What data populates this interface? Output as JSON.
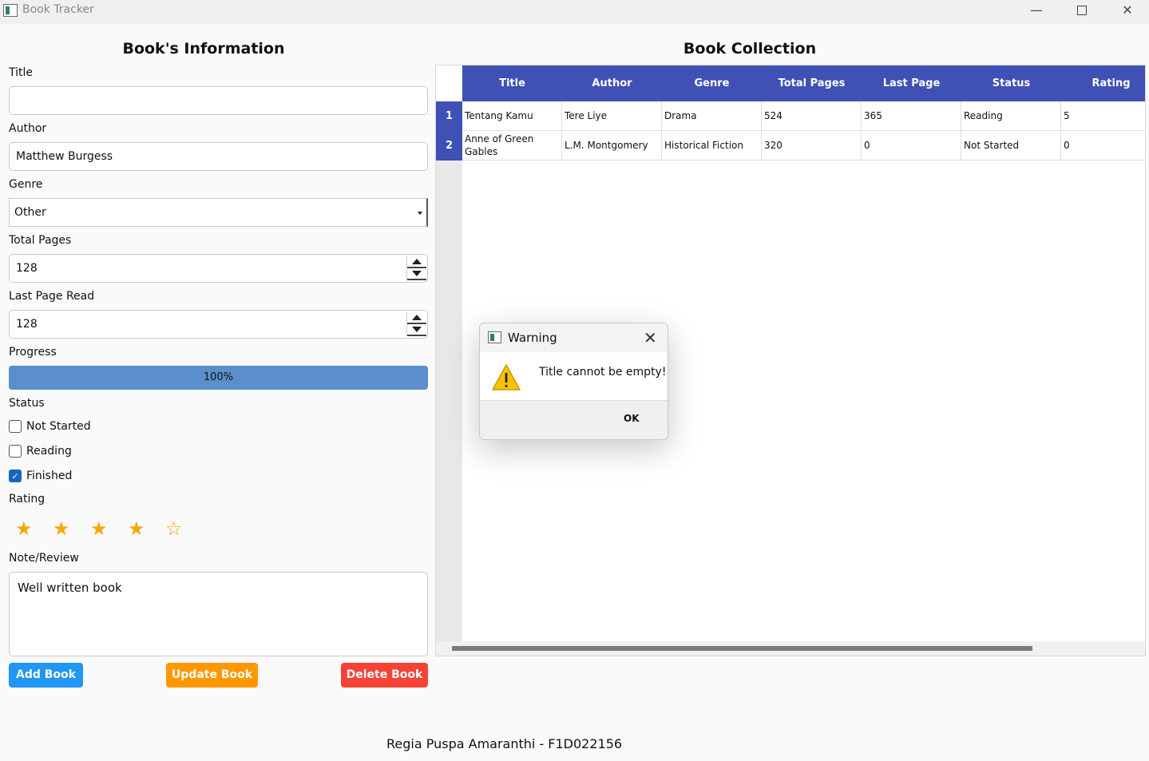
{
  "window": {
    "title": "Book Tracker",
    "minimize": "—",
    "close": "✕"
  },
  "form": {
    "heading": "Book's Information",
    "title_label": "Title",
    "title_value": "",
    "author_label": "Author",
    "author_value": "Matthew Burgess",
    "genre_label": "Genre",
    "genre_value": "Other",
    "total_pages_label": "Total Pages",
    "total_pages_value": "128",
    "last_page_label": "Last Page Read",
    "last_page_value": "128",
    "progress_label": "Progress",
    "progress_value": 1.0,
    "progress_text": "100%",
    "progress_color": "#5a8fcb",
    "status_label": "Status",
    "status_options": [
      {
        "label": "Not Started",
        "checked": false
      },
      {
        "label": "Reading",
        "checked": false
      },
      {
        "label": "Finished",
        "checked": true
      }
    ],
    "rating_label": "Rating",
    "rating_value": 4,
    "rating_max": 5,
    "note_label": "Note/Review",
    "note_value": "Well written book",
    "buttons": {
      "add": "Add Book",
      "update": "Update Book",
      "delete": "Delete Book"
    }
  },
  "collection": {
    "heading": "Book Collection",
    "header_color": "#3f51b5",
    "columns": [
      "Title",
      "Author",
      "Genre",
      "Total Pages",
      "Last Page",
      "Status",
      "Rating"
    ],
    "rows": [
      {
        "index": "1",
        "cells": [
          "Tentang Kamu",
          "Tere Liye",
          "Drama",
          "524",
          "365",
          "Reading",
          "5"
        ]
      },
      {
        "index": "2",
        "cells": [
          "Anne of Green Gables",
          "L.M. Montgomery",
          "Historical Fiction",
          "320",
          "0",
          "Not Started",
          "0"
        ]
      }
    ]
  },
  "footer": {
    "text": "Regia Puspa Amaranthi - F1D022156"
  },
  "dialog": {
    "title": "Warning",
    "message": "Title cannot be empty!",
    "ok_label": "OK",
    "close": "✕",
    "icon": "warning-icon"
  }
}
